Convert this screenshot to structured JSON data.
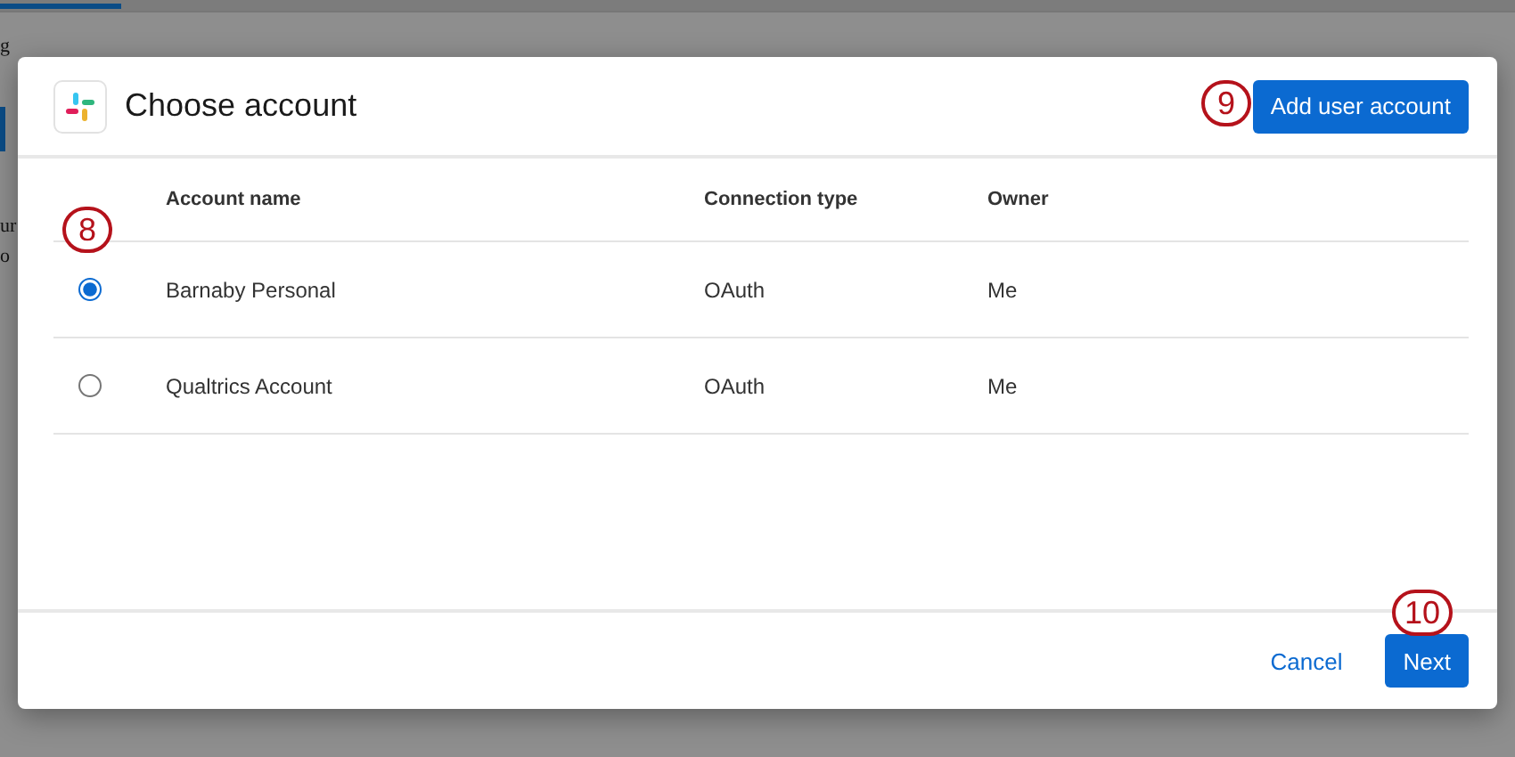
{
  "backdrop": {
    "fragments": [
      "g",
      "ur",
      "o"
    ]
  },
  "dialog": {
    "title": "Choose account",
    "add_button": "Add user account",
    "table": {
      "columns": [
        "Account name",
        "Connection type",
        "Owner"
      ],
      "rows": [
        {
          "selected": true,
          "cells": [
            "Barnaby Personal",
            "OAuth",
            "Me"
          ]
        },
        {
          "selected": false,
          "cells": [
            "Qualtrics Account",
            "OAuth",
            "Me"
          ]
        }
      ]
    },
    "cancel_button": "Cancel",
    "next_button": "Next"
  },
  "callouts": [
    {
      "label": "8"
    },
    {
      "label": "9"
    },
    {
      "label": "10"
    }
  ]
}
